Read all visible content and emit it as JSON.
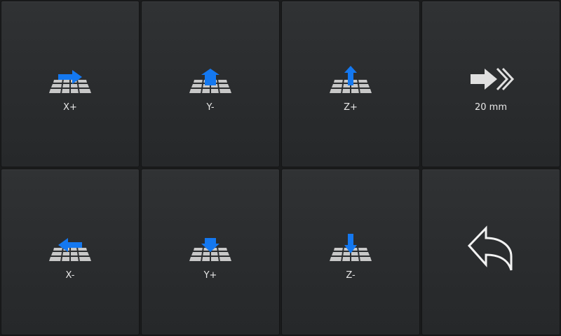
{
  "tiles": {
    "x_plus": {
      "label": "X+"
    },
    "y_minus": {
      "label": "Y-"
    },
    "z_plus": {
      "label": "Z+"
    },
    "step": {
      "label": "20 mm"
    },
    "x_minus": {
      "label": "X-"
    },
    "y_plus": {
      "label": "Y+"
    },
    "z_minus": {
      "label": "Z-"
    },
    "back": {
      "label": ""
    }
  },
  "colors": {
    "accent_arrow": "#1478f0",
    "bed_grid": "#c8c8c8",
    "tile_bg": "#2b2d2f",
    "label_text": "#e8e8e8"
  },
  "icons": {
    "x_plus": "bed-arrow-right-icon",
    "y_minus": "bed-arrow-back-icon",
    "z_plus": "bed-arrow-up-icon",
    "step": "fast-forward-icon",
    "x_minus": "bed-arrow-left-icon",
    "y_plus": "bed-arrow-front-icon",
    "z_minus": "bed-arrow-down-icon",
    "back": "back-arrow-icon"
  }
}
